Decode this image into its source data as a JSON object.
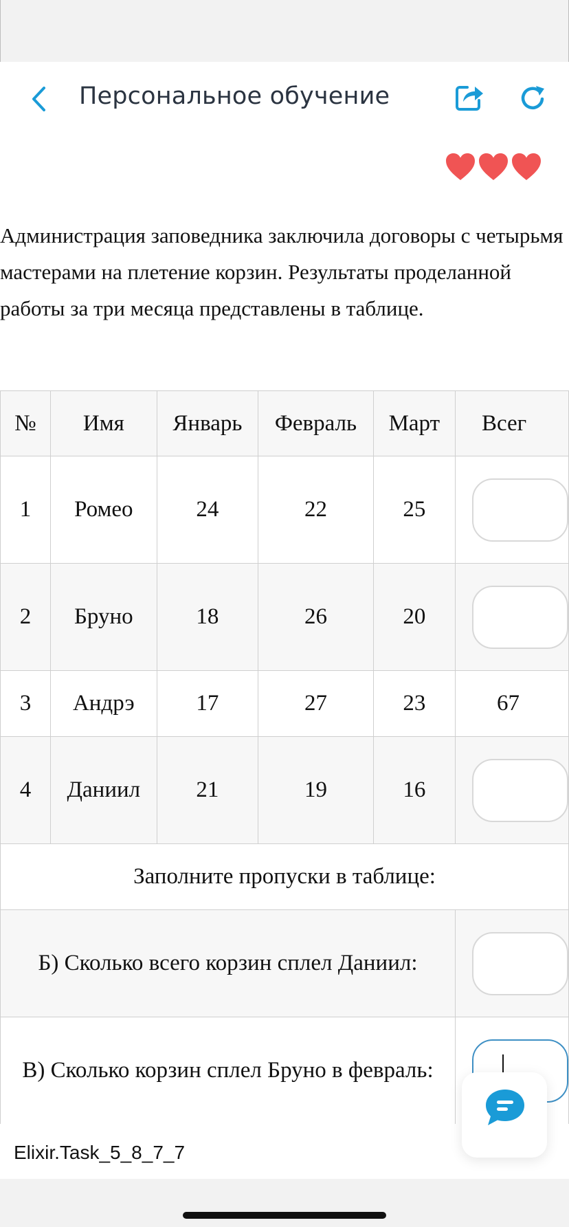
{
  "header": {
    "title": "Персональное обучение",
    "back_icon": "chevron-left-icon",
    "share_icon": "share-icon",
    "refresh_icon": "refresh-icon",
    "accent_color": "#1a9bd7"
  },
  "lives": {
    "count": 3,
    "icon": "heart-icon",
    "color": "#f05454"
  },
  "question": {
    "text": "Администрация заповедника заключила договоры с четырьмя мастерами на плетение корзин. Результаты проделанной работы за три месяца представлены в таблице."
  },
  "table": {
    "headers": [
      "№",
      "Имя",
      "Январь",
      "Февраль",
      "Март",
      "Всег"
    ],
    "rows": [
      {
        "num": "1",
        "name": "Ромео",
        "jan": "24",
        "feb": "22",
        "mar": "25",
        "total": ""
      },
      {
        "num": "2",
        "name": "Бруно",
        "jan": "18",
        "feb": "26",
        "mar": "20",
        "total": ""
      },
      {
        "num": "3",
        "name": "Андрэ",
        "jan": "17",
        "feb": "27",
        "mar": "23",
        "total": "67"
      },
      {
        "num": "4",
        "name": "Даниил",
        "jan": "21",
        "feb": "19",
        "mar": "16",
        "total": ""
      }
    ],
    "instruction": "Заполните пропуски в таблице:",
    "questions": [
      {
        "text": "Б) Сколько всего корзин сплел Даниил:",
        "answer": ""
      },
      {
        "text": "В) Сколько корзин сплел Бруно в февраль:",
        "answer": ""
      }
    ]
  },
  "footer": {
    "task_id": "Elixir.Task_5_8_7_7",
    "chat_icon": "chat-bubble-icon"
  }
}
